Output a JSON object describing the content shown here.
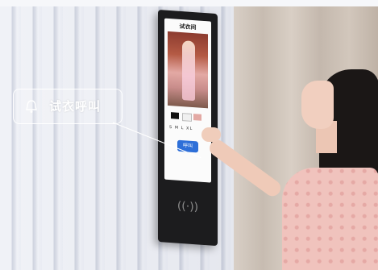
{
  "callout": {
    "icon": "bell-icon",
    "text": "试衣呼叫"
  },
  "screen": {
    "title": "试衣间",
    "sizes": "S M L XL",
    "call_button": "呼叫",
    "nfc_symbol": "((·))"
  },
  "colors": {
    "device": "#1c1c1e",
    "call_button": "#2e6fd8",
    "callout_border": "#ffffff"
  }
}
